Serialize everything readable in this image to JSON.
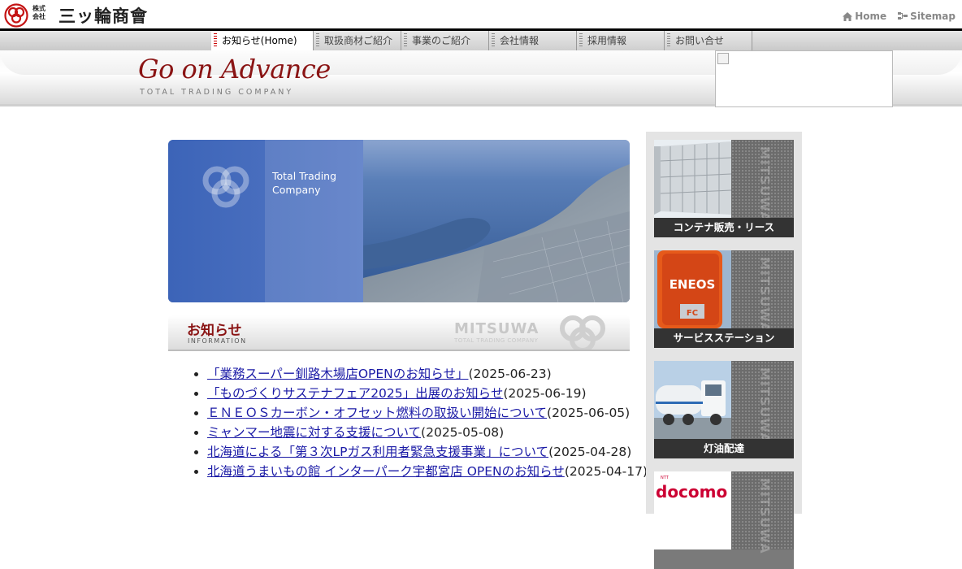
{
  "company": {
    "logo_small_top": "株式",
    "logo_small_bottom": "会社",
    "name": "三ッ輪商會"
  },
  "utility_links": [
    {
      "label": "Home",
      "icon": "home-icon"
    },
    {
      "label": "Sitemap",
      "icon": "sitemap-icon"
    }
  ],
  "nav": {
    "tabs": [
      {
        "label": "お知らせ(Home)",
        "active": true
      },
      {
        "label": "取扱商材ご紹介"
      },
      {
        "label": "事業のご紹介"
      },
      {
        "label": "会社情報"
      },
      {
        "label": "採用情報"
      },
      {
        "label": "お問い合せ"
      }
    ]
  },
  "banner": {
    "slogan": "Go on Advance",
    "sub": "TOTAL TRADING COMPANY"
  },
  "hero": {
    "line1": "Total Trading",
    "line2": "Company"
  },
  "news": {
    "title": "お知らせ",
    "subtitle": "INFORMATION",
    "brand": "MITSUWA",
    "brand_sub": "TOTAL TRADING COMPANY",
    "items": [
      {
        "link": "「業務スーパー釧路木場店OPENのお知らせ」",
        "date": "(2025-06-23)"
      },
      {
        "link": "「ものづくりサステナフェア2025」出展のお知らせ",
        "date": "(2025-06-19)"
      },
      {
        "link": "ＥＮＥＯＳカーボン・オフセット燃料の取扱い開始について",
        "date": "(2025-06-05)"
      },
      {
        "link": "ミャンマー地震に対する支援について",
        "date": "(2025-05-08)"
      },
      {
        "link": "北海道による「第３次LPガス利用者緊急支援事業」について",
        "date": "(2025-04-28)"
      },
      {
        "link": "北海道うまいもの館 インターパーク宇都宮店 OPENのお知らせ",
        "date": "(2025-04-17)"
      }
    ]
  },
  "sidebar": {
    "stripe_text": "MITSUWA",
    "cards": [
      {
        "label": "コンテナ販売・リース"
      },
      {
        "label": "サービスステーション",
        "sign_text": "ENEOS",
        "sign_sub": "FC"
      },
      {
        "label": "灯油配達"
      },
      {
        "label": "",
        "logo_text": "docomo",
        "logo_sub": "NTT"
      }
    ]
  },
  "colors": {
    "brand_red": "#8a1414",
    "link_blue": "#1a1aa6",
    "nav_gray": "#cfcfcf",
    "card_label_bg": "#333333"
  }
}
